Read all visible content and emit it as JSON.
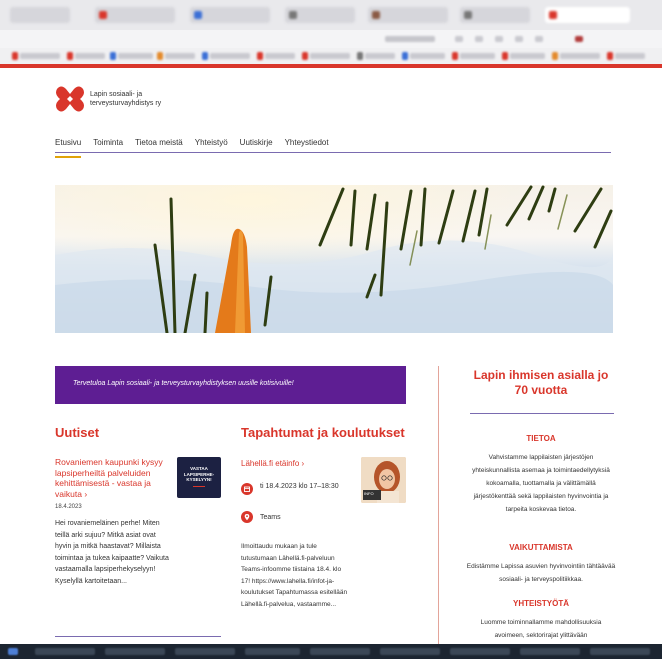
{
  "site": {
    "logo_text_line1": "Lapin sosiaali- ja",
    "logo_text_line2": "terveysturvayhdistys ry",
    "brand_color": "#d9362b",
    "accent_purple": "#5e1e93"
  },
  "nav": {
    "items": [
      "Etusivu",
      "Toiminta",
      "Tietoa meistä",
      "Yhteistyö",
      "Uutiskirje",
      "Yhteystiedot"
    ],
    "active": "Etusivu"
  },
  "welcome": {
    "text": "Tervetuloa Lapin sosiaali- ja terveysturvayhdistyksen uusille kotisivuille!"
  },
  "news": {
    "heading": "Uutiset",
    "title": "Rovaniemen kaupunki kysyy lapsiperheiltä palveluiden kehittämisestä - vastaa ja vaikuta",
    "arrow": "›",
    "date": "18.4.2023",
    "body": "Hei rovaniemeläinen perhe! Miten teillä arki sujuu? Mitkä asiat ovat hyvin ja mitkä haastavat? Millaista toimintaa ja tukea kaipaatte? Vaikuta vastaamalla lapsiperhekyselyyn! Kyselyllä kartoitetaan...",
    "thumb_text": "VASTAA LAPSIPERHE-KYSELYYN!"
  },
  "events": {
    "heading": "Tapahtumat ja koulutukset",
    "title": "Lähellä.fi etäinfo",
    "arrow": "›",
    "date": "ti 18.4.2023 klo 17–18:30",
    "location": "Teams",
    "thumb_badge": "INFO",
    "body": "Ilmoittaudu mukaan ja tule tutustumaan Lähellä.fi-palveluun Teams-infoomme tiistaina 18.4. klo 17! https://www.lahella.fi/infot-ja-koulutukset Tapahtumassa esitellään Lähellä.fi-palvelua, vastaamme..."
  },
  "sidebar": {
    "heading": "Lapin ihmisen asialla jo 70 vuotta",
    "sections": [
      {
        "title": "TIETOA",
        "text": "Vahvistamme lappilaisten järjestöjen yhteiskunnallista asemaa ja toimintaedellytyksiä kokoamalla, tuottamalla ja välittämällä järjestökenttää sekä lappilaisten hyvinvointia ja tarpeita koskevaa tietoa."
      },
      {
        "title": "VAIKUTTAMISTA",
        "text": "Edistämme Lapissa asuvien hyvinvointiin tähtäävää sosiaali- ja terveyspolitiikkaa."
      },
      {
        "title": "YHTEISTYÖTÄ",
        "text": "Luomme toiminnallamme mahdollisuuksia avoimeen, sektorirajat ylittävään"
      }
    ]
  }
}
